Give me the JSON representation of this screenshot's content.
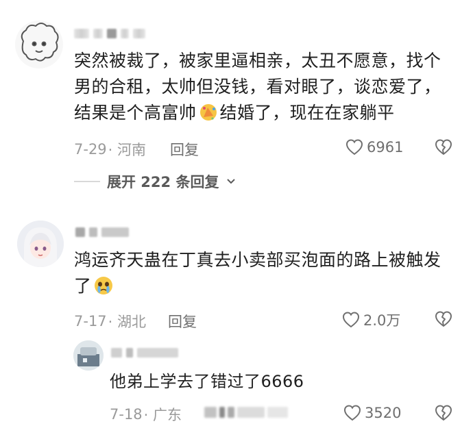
{
  "comments": [
    {
      "text_line1": "突然被裁了，被家里逼相亲，太丑不愿意，找个",
      "text_line2": "男的合租，太帅但没钱，看对眼了，谈恋爱了，",
      "text_line3_a": "结果是个高富帅",
      "text_line3_b": "结婚了，现在在家躺平",
      "date": "7-29",
      "location": "· 河南",
      "reply_label": "回复",
      "likes": "6961",
      "emoji_icon": "celebration-emoji-icon"
    },
    {
      "text_line1": "鸿运齐天蛊在丁真去小卖部买泡面的路上被触发",
      "text_line2": "了",
      "date": "7-17",
      "location": "· 湖北",
      "reply_label": "回复",
      "likes": "2.0万",
      "emoji_icon": "crying-face-emoji-icon"
    }
  ],
  "expand_replies": "展开 222 条回复",
  "reply": {
    "text": "他弟上学去了错过了6666",
    "date": "7-18",
    "location": "· 广东",
    "likes": "3520"
  },
  "colors": {
    "text": "#1f1f1f",
    "meta": "#9a9a9a",
    "icon": "#6f6f6f"
  }
}
